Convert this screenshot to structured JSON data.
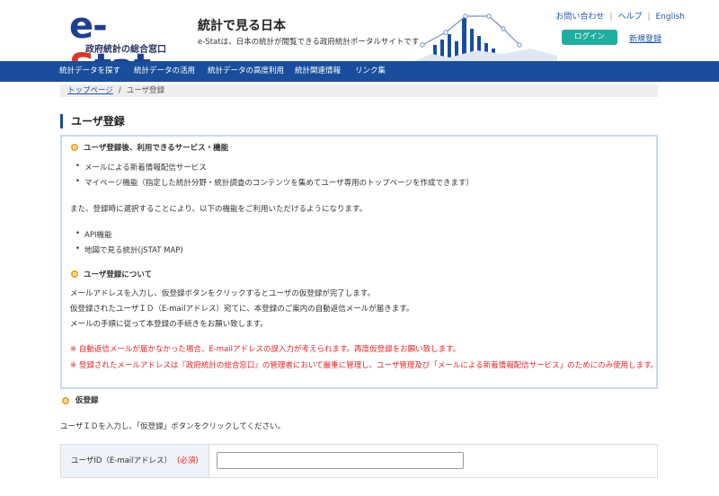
{
  "header": {
    "logo_text_e": "e-",
    "logo_text_s": "S",
    "logo_text_rest": "tat",
    "logo_sub": "政府統計の総合窓口",
    "tagline_title": "統計で見る日本",
    "tagline_desc": "e-Statは、日本の統計が閲覧できる政府統計ポータルサイトです",
    "links": [
      "お問い合わせ",
      "ヘルプ",
      "English"
    ],
    "login_label": "ログイン",
    "register_label": "新規登録"
  },
  "nav": {
    "items": [
      "統計データを探す",
      "統計データの活用",
      "統計データの高度利用",
      "統計関連情報",
      "リンク集"
    ]
  },
  "breadcrumb": {
    "home": "トップページ",
    "current": "ユーザ登録"
  },
  "page_title": "ユーザ登録",
  "info": {
    "section1_title": "ユーザ登録後、利用できるサービス・機能",
    "section1_items": [
      "メールによる新着情報配信サービス",
      "マイページ機能（指定した統計分野・統計調査のコンテンツを集めてユーザ専用のトップページを作成できます）"
    ],
    "section1_para": "また、登録時に選択することにより、以下の機能をご利用いただけるようになります。",
    "section1_items2": [
      "API機能",
      "地図で見る統計(jSTAT MAP)"
    ],
    "section2_title": "ユーザ登録について",
    "section2_paras": [
      "メールアドレスを入力し、仮登録ボタンをクリックするとユーザの仮登録が完了します。",
      "仮登録されたユーザＩＤ（E-mailアドレス）宛てに、本登録のご案内の自動返信メールが届きます。",
      "メールの手順に従って本登録の手続きをお願い致します。"
    ],
    "notices": [
      "※ 自動返信メールが届かなかった場合、E-mailアドレスの誤入力が考えられます。再度仮登録をお願い致します。",
      "※ 登録されたメールアドレスは『政府統計の総合窓口』の管理者において厳重に管理し、ユーザ管理及び「メールによる新着情報配信サービス」のためにのみ使用します。"
    ]
  },
  "temp_registration": {
    "title": "仮登録",
    "desc": "ユーザＩＤを入力し、「仮登録」ボタンをクリックしてください。",
    "field_label": "ユーザID（E-mailアドレス）",
    "required_label": "(必須)",
    "email_value": ""
  },
  "colors": {
    "nav_bg": "#1a4e9c",
    "login_bg": "#21ad9e",
    "notice": "#e22525",
    "accent_orange": "#f0a020"
  }
}
